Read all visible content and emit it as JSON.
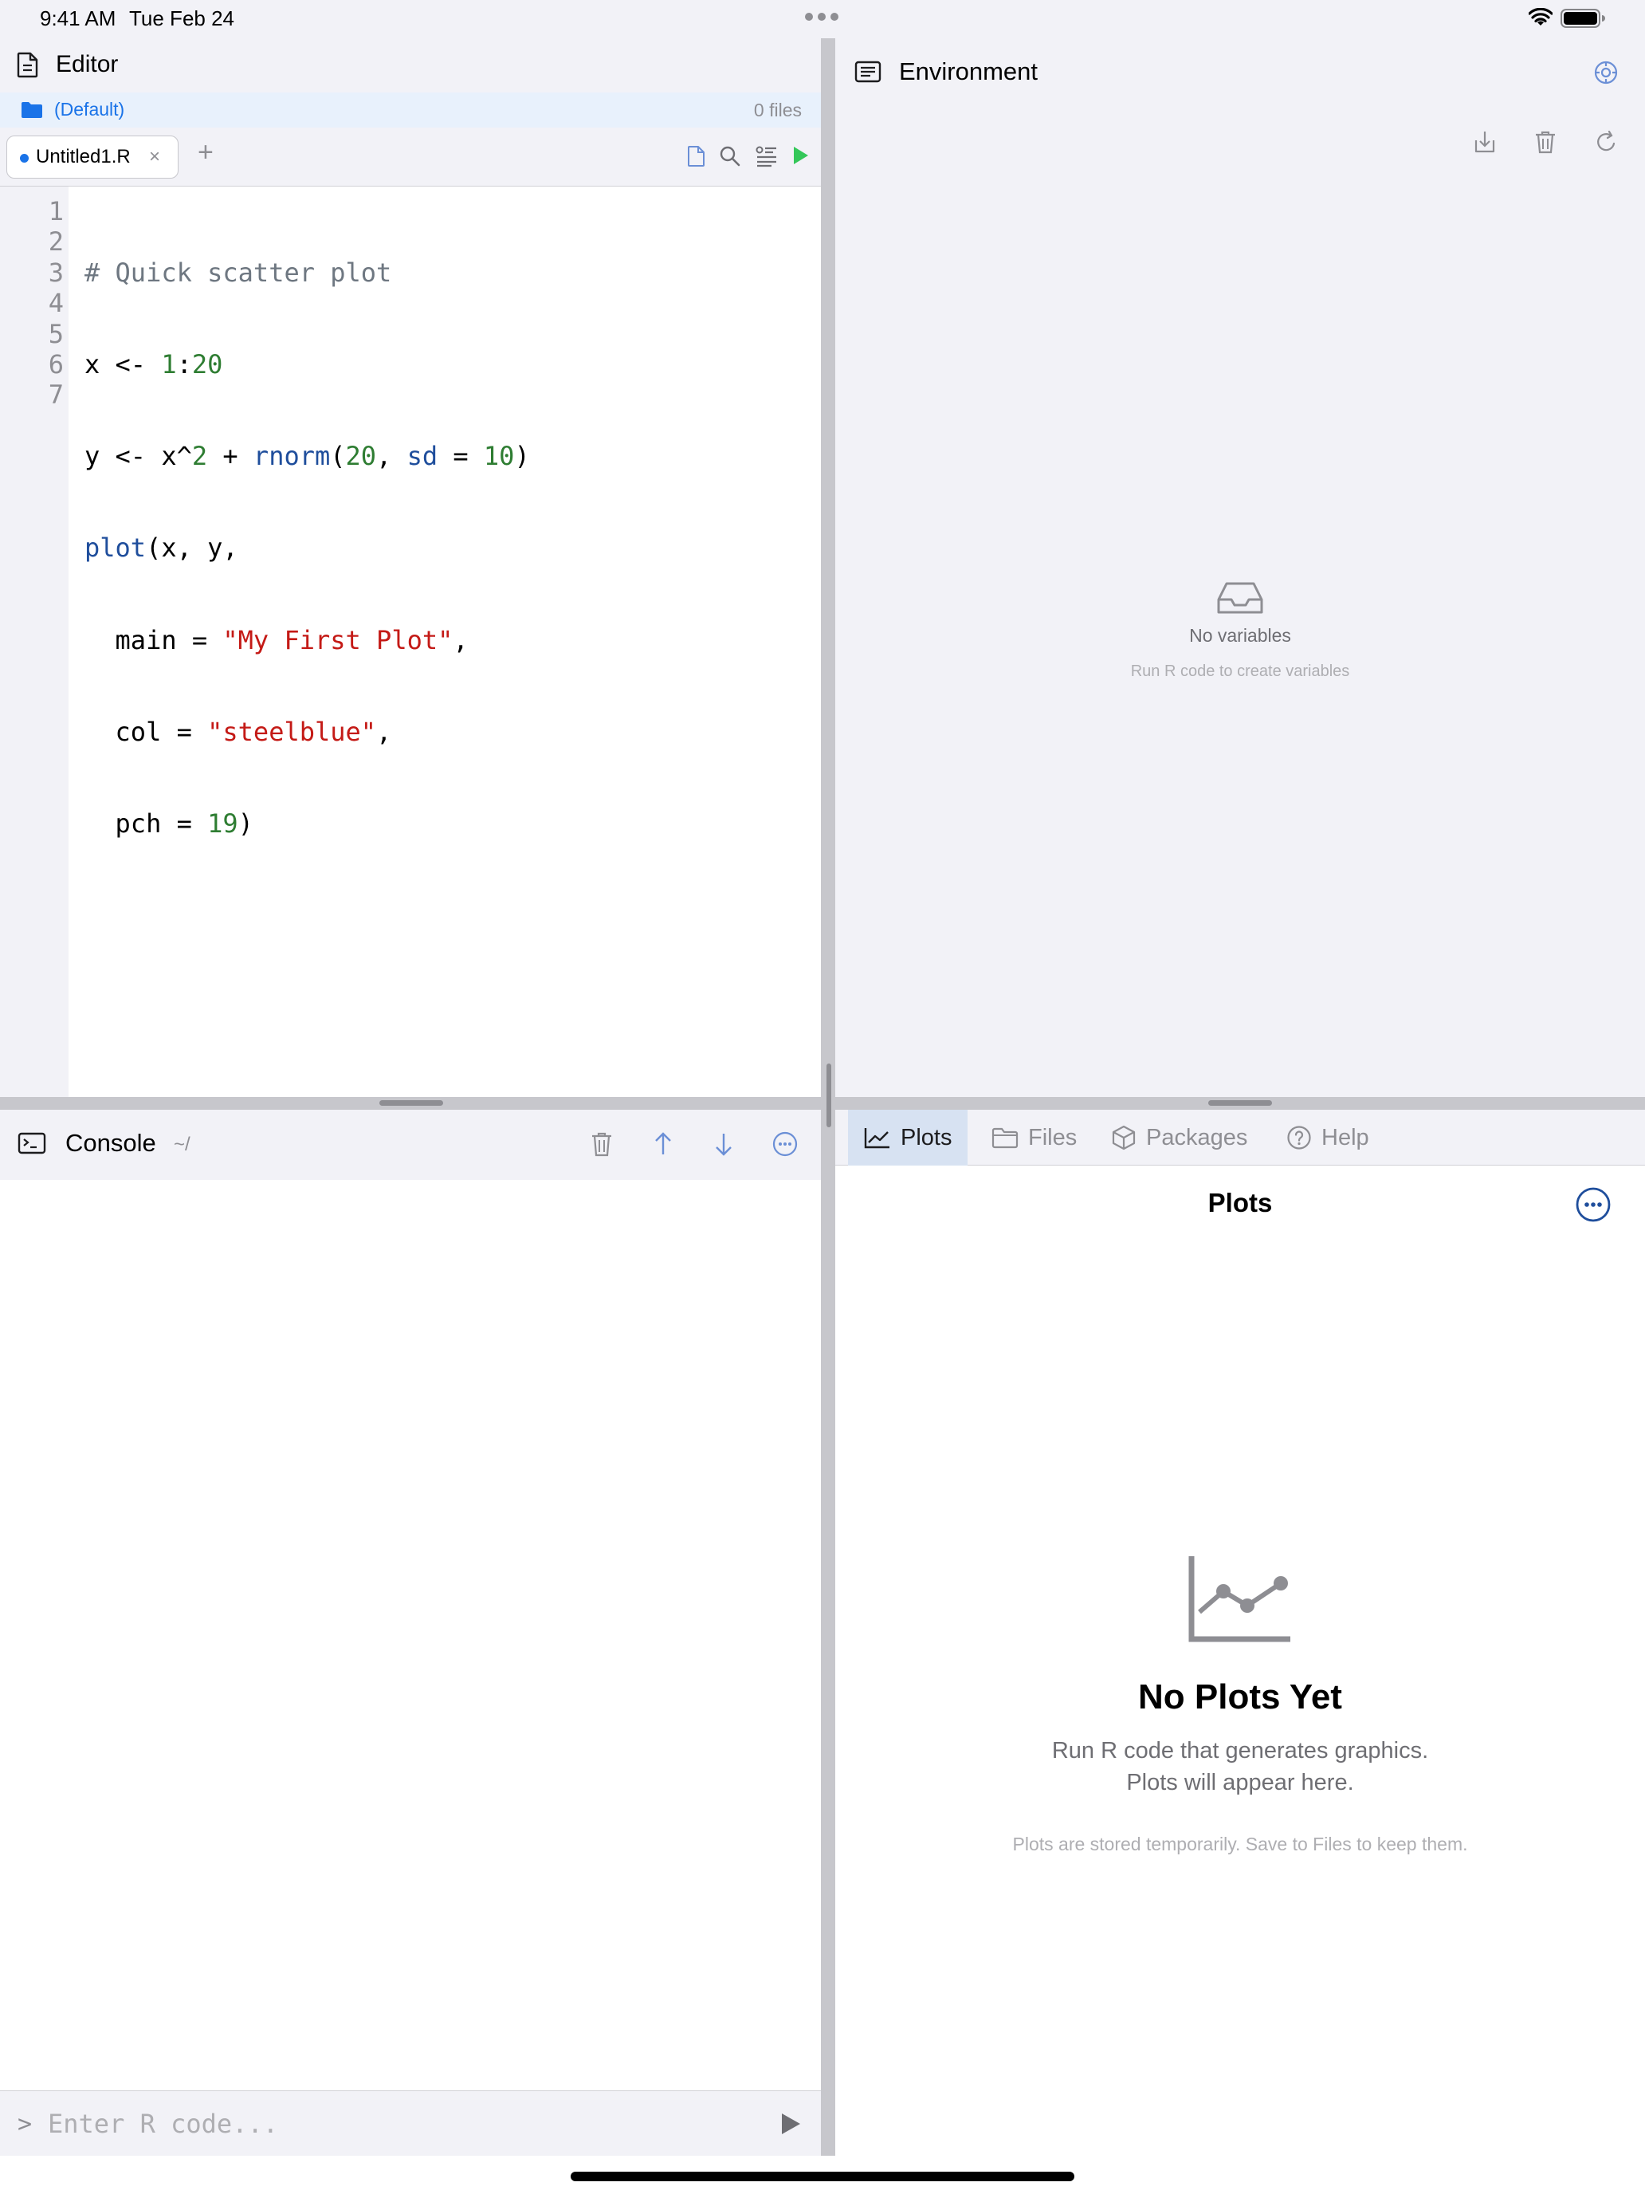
{
  "status_bar": {
    "time": "9:41 AM",
    "date": "Tue Feb 24"
  },
  "editor": {
    "title": "Editor",
    "project_name": "(Default)",
    "file_count": "0 files",
    "tab_label": "Untitled1.R",
    "tab_close": "×",
    "tab_add": "+",
    "line_numbers": [
      "1",
      "2",
      "3",
      "4",
      "5",
      "6",
      "7"
    ],
    "code_lines": [
      "# Quick scatter plot",
      "x <- 1:20",
      "y <- x^2 + rnorm(20, sd = 10)",
      "plot(x, y,",
      "  main = \"My First Plot\",",
      "  col = \"steelblue\",",
      "  pch = 19)"
    ]
  },
  "environment": {
    "title": "Environment",
    "empty_title": "No variables",
    "empty_subtitle": "Run R code to create variables"
  },
  "console": {
    "title": "Console",
    "path": "~/",
    "prompt": ">",
    "input_placeholder": "Enter R code..."
  },
  "plots": {
    "tabs": [
      {
        "label": "Plots",
        "icon": "chart-line-icon",
        "active": true
      },
      {
        "label": "Files",
        "icon": "folder-icon",
        "active": false
      },
      {
        "label": "Packages",
        "icon": "package-icon",
        "active": false
      },
      {
        "label": "Help",
        "icon": "help-icon",
        "active": false
      }
    ],
    "title": "Plots",
    "empty_title": "No Plots Yet",
    "empty_line1": "Run R code that generates graphics.",
    "empty_line2": "Plots will appear here.",
    "empty_note": "Plots are stored temporarily. Save to Files to keep them."
  },
  "colors": {
    "accent": "#1a73e8",
    "run_green": "#34c759",
    "toolbar_blue": "#6b8fd6",
    "string_red": "#c41a16",
    "number_green": "#2e7d32",
    "function_blue": "#1f4e9c"
  }
}
